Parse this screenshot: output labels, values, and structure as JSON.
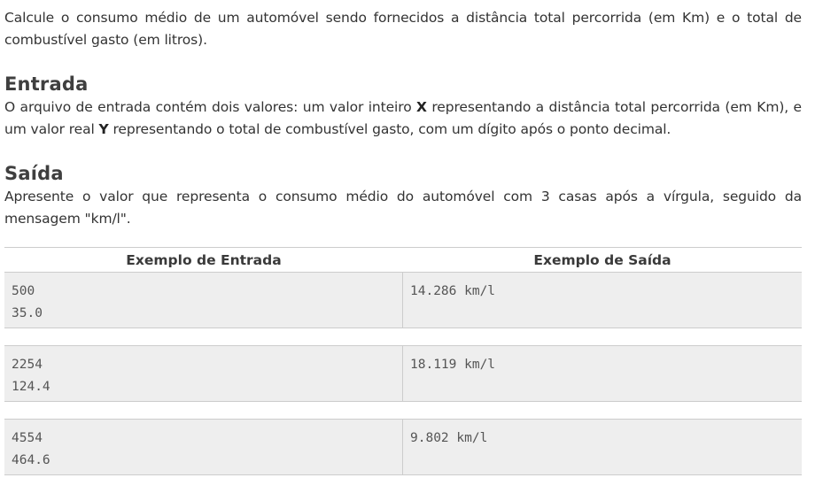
{
  "intro": "Calcule o consumo médio de um automóvel sendo fornecidos a distância total percorrida (em Km) e o total de combustível gasto (em litros).",
  "entrada": {
    "heading": "Entrada",
    "text_1": "O arquivo de entrada contém dois valores: um valor inteiro ",
    "var_x": "X",
    "text_2": " representando a distância total percorrida (em Km), e um valor real ",
    "var_y": "Y",
    "text_3": " representando o total de combustível gasto, com um dígito após o ponto decimal."
  },
  "saida": {
    "heading": "Saída",
    "text": "Apresente o valor que representa o consumo médio do automóvel com 3 casas após a vírgula, seguido da mensagem \"km/l\"."
  },
  "samples": {
    "input_header": "Exemplo de Entrada",
    "output_header": "Exemplo de Saída",
    "rows": [
      {
        "input": "500\n35.0",
        "output": "14.286 km/l"
      },
      {
        "input": "2254\n124.4",
        "output": "18.119 km/l"
      },
      {
        "input": "4554\n464.6",
        "output": "9.802 km/l"
      }
    ]
  }
}
